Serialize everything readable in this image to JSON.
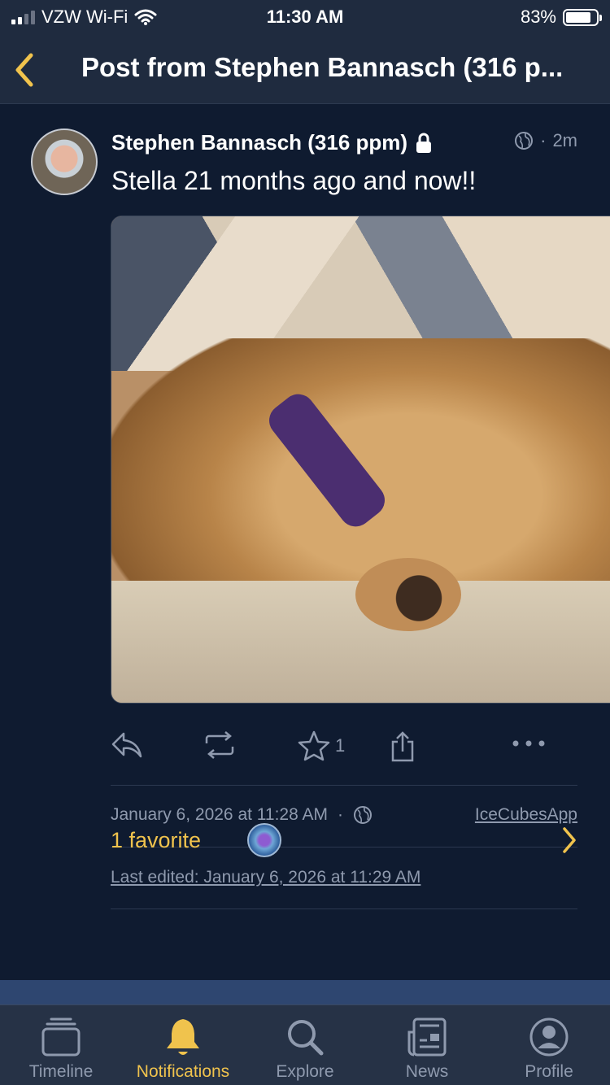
{
  "status_bar": {
    "carrier": "VZW Wi-Fi",
    "time": "11:30 AM",
    "battery": "83%"
  },
  "nav": {
    "title": "Post from Stephen Bannasch (316 p..."
  },
  "post": {
    "author": "Stephen Bannasch (316 ppm)",
    "age": "2m",
    "content": "Stella 21 months ago and now!!",
    "favorite_count": "1"
  },
  "details": {
    "date": "January 6, 2026 at 11:28 AM",
    "separator": "·",
    "app": "IceCubesApp",
    "edited": "Last edited: January 6, 2026 at 11:29 AM"
  },
  "favorites": {
    "label": "1 favorite"
  },
  "tabs": [
    {
      "label": "Timeline",
      "icon": "timeline-icon"
    },
    {
      "label": "Notifications",
      "icon": "bell-icon"
    },
    {
      "label": "Explore",
      "icon": "search-icon"
    },
    {
      "label": "News",
      "icon": "newspaper-icon"
    },
    {
      "label": "Profile",
      "icon": "profile-icon"
    }
  ],
  "colors": {
    "background": "#0f1b30",
    "accent": "#f0c34d",
    "muted": "#8f9aae"
  }
}
